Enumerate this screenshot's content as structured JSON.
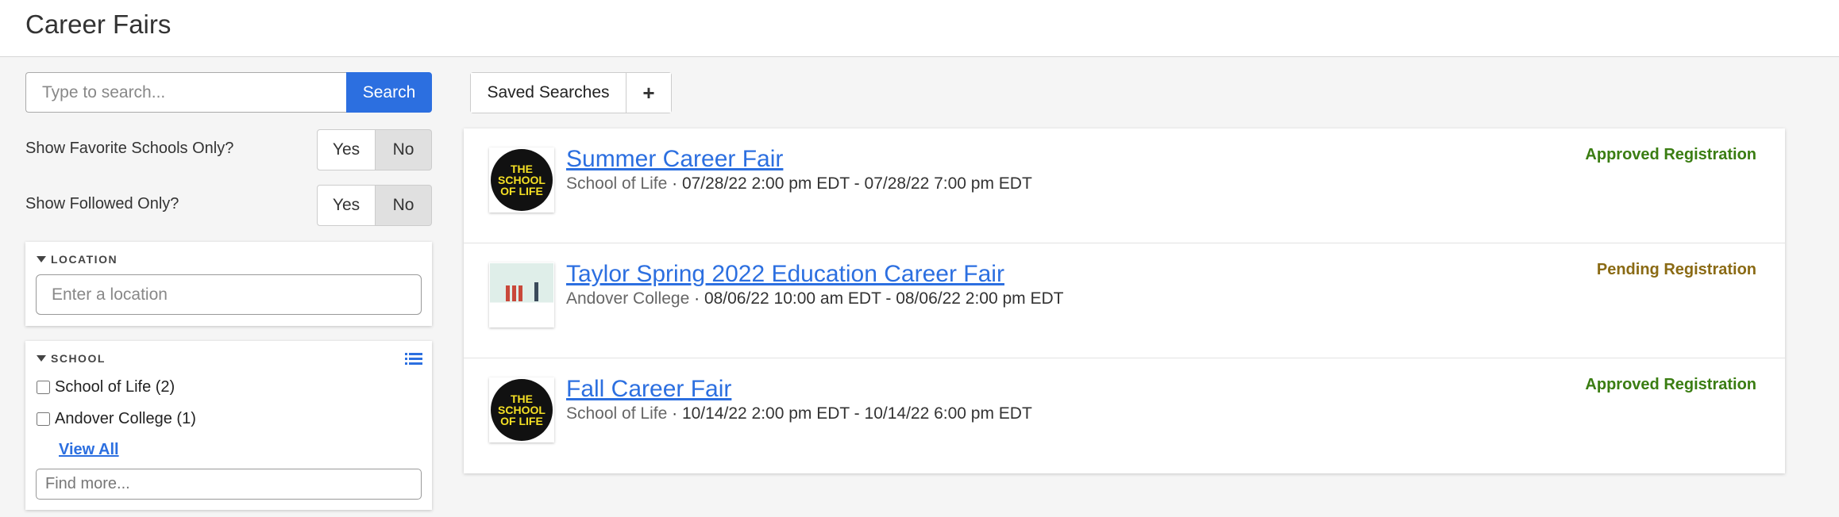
{
  "header": {
    "title": "Career Fairs"
  },
  "search": {
    "placeholder": "Type to search...",
    "button_label": "Search"
  },
  "filters": {
    "favorite_schools": {
      "label": "Show Favorite Schools Only?",
      "yes": "Yes",
      "no": "No",
      "selected": "No"
    },
    "followed": {
      "label": "Show Followed Only?",
      "yes": "Yes",
      "no": "No",
      "selected": "No"
    }
  },
  "location_panel": {
    "title": "LOCATION",
    "placeholder": "Enter a location"
  },
  "school_panel": {
    "title": "SCHOOL",
    "options": [
      {
        "label": "School of Life (2)",
        "checked": false
      },
      {
        "label": "Andover College (1)",
        "checked": false
      }
    ],
    "view_all": "View All",
    "find_placeholder": "Find more..."
  },
  "saved_searches": {
    "label": "Saved Searches",
    "add_symbol": "+"
  },
  "fairs": [
    {
      "title": "Summer Career Fair",
      "school": "School of Life",
      "separator": " · ",
      "dates": "07/28/22 2:00 pm EDT - 07/28/22 7:00 pm EDT",
      "status": "Approved Registration",
      "status_color": "#3a7d12",
      "logo": "school-of-life-logo",
      "logo_text": "THE\nSCHOOL\nOF LIFE"
    },
    {
      "title": "Taylor Spring 2022 Education Career Fair",
      "school": "Andover College",
      "separator": " · ",
      "dates": "08/06/22 10:00 am EDT - 08/06/22 2:00 pm EDT",
      "status": "Pending Registration",
      "status_color": "#8a6a14",
      "logo": "andover-college-photo",
      "logo_text": ""
    },
    {
      "title": "Fall Career Fair",
      "school": "School of Life",
      "separator": " · ",
      "dates": "10/14/22 2:00 pm EDT - 10/14/22 6:00 pm EDT",
      "status": "Approved Registration",
      "status_color": "#3a7d12",
      "logo": "school-of-life-logo",
      "logo_text": "THE\nSCHOOL\nOF LIFE"
    }
  ],
  "colors": {
    "accent": "#2c6fe0",
    "approved": "#3a7d12",
    "pending": "#8a6a14"
  }
}
